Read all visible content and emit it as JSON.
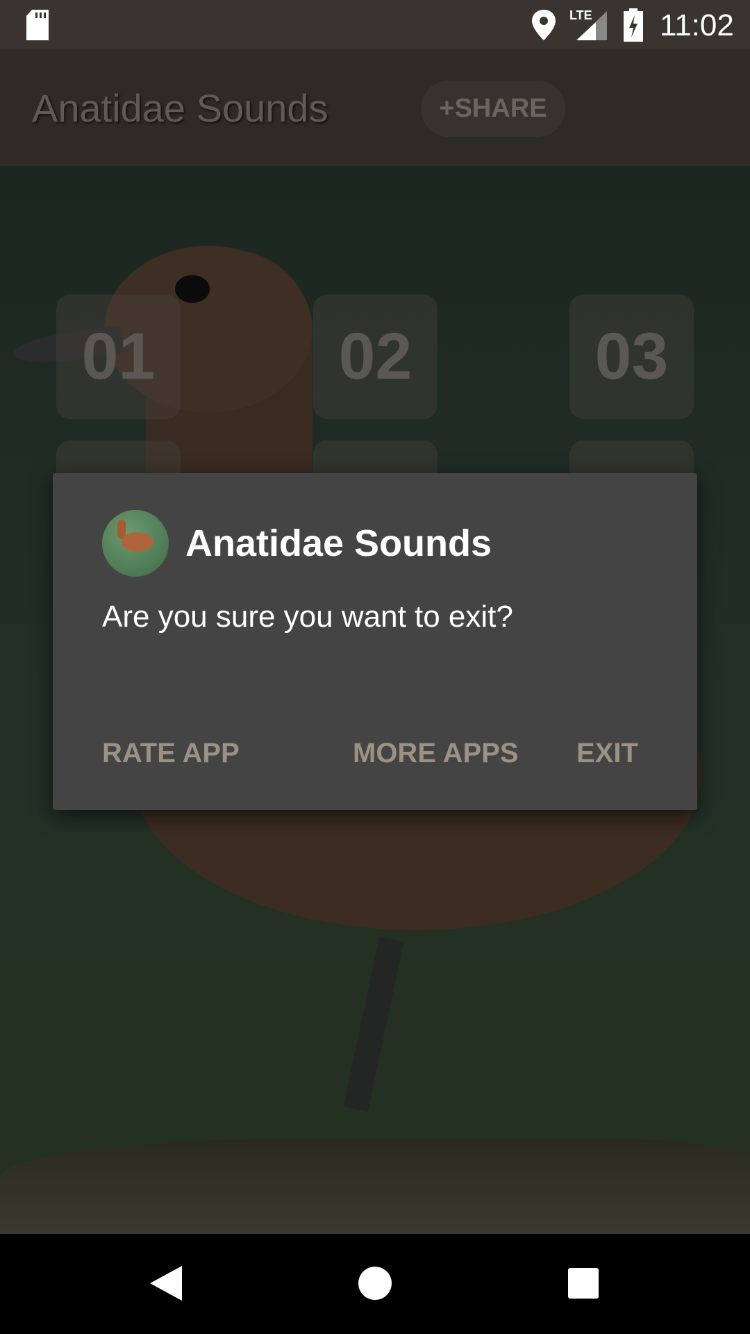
{
  "status_bar": {
    "time": "11:02",
    "network": "LTE",
    "icons": [
      "sd-card-icon",
      "location-icon",
      "signal-icon",
      "battery-charging-icon"
    ]
  },
  "app_bar": {
    "title": "Anatidae Sounds",
    "share_label": "+SHARE"
  },
  "tiles": [
    {
      "label": "01"
    },
    {
      "label": "02"
    },
    {
      "label": "03"
    }
  ],
  "dialog": {
    "title": "Anatidae Sounds",
    "message": "Are you sure you want to exit?",
    "buttons": {
      "rate": "RATE APP",
      "more": "MORE APPS",
      "exit": "EXIT"
    },
    "button_color": "#9b9185"
  },
  "nav_bar": {
    "icons": [
      "back-icon",
      "home-icon",
      "recents-icon"
    ]
  }
}
